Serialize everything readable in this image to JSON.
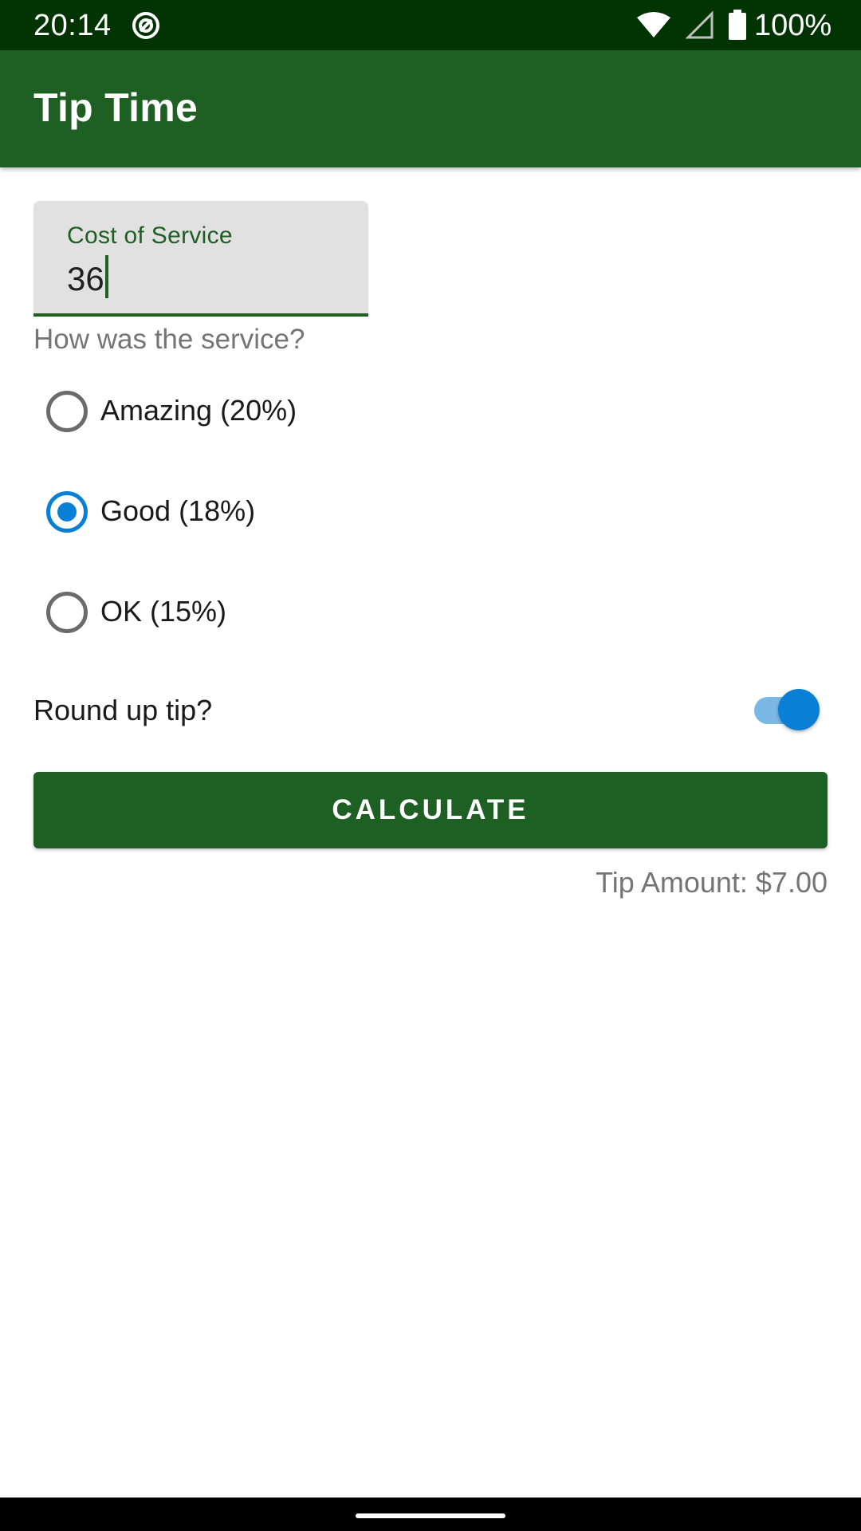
{
  "status_bar": {
    "time": "20:14",
    "battery": "100%",
    "icons": [
      "notification-icon",
      "wifi-icon",
      "signal-icon",
      "battery-icon"
    ]
  },
  "app_bar": {
    "title": "Tip Time"
  },
  "cost_field": {
    "label": "Cost of Service",
    "value": "36"
  },
  "service_question": "How was the service?",
  "tip_options": [
    {
      "label": "Amazing (20%)",
      "selected": false
    },
    {
      "label": "Good (18%)",
      "selected": true
    },
    {
      "label": "OK (15%)",
      "selected": false
    }
  ],
  "round_up": {
    "label": "Round up tip?",
    "enabled": true
  },
  "calculate_button": {
    "label": "CALCULATE"
  },
  "tip_result": "Tip Amount: $7.00",
  "colors": {
    "status_bar": "#023302",
    "primary": "#1e5f23",
    "accent": "#0a7fd6",
    "secondary_text": "#757575"
  }
}
